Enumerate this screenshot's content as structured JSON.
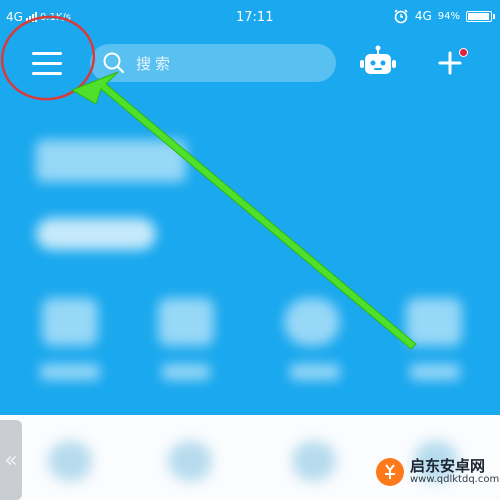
{
  "status_bar": {
    "network": "4G",
    "speed": "0.1K/s",
    "time": "17:11",
    "network_right": "4G",
    "battery": "94%",
    "battery_level": 0.94
  },
  "topbar": {
    "menu_icon": "hamburger-menu-icon",
    "search_placeholder": "搜索",
    "robot_icon": "robot-icon",
    "add_icon": "plus-icon",
    "notification_color": "#e2213c"
  },
  "side_tab": {
    "glyph": "«"
  },
  "watermark": {
    "title": "启东安卓网",
    "url": "www.qdlktdq.com"
  },
  "colors": {
    "background": "#1aa8ee",
    "annotation_circle": "#d93a3a",
    "annotation_arrow": "#4ee02a"
  }
}
